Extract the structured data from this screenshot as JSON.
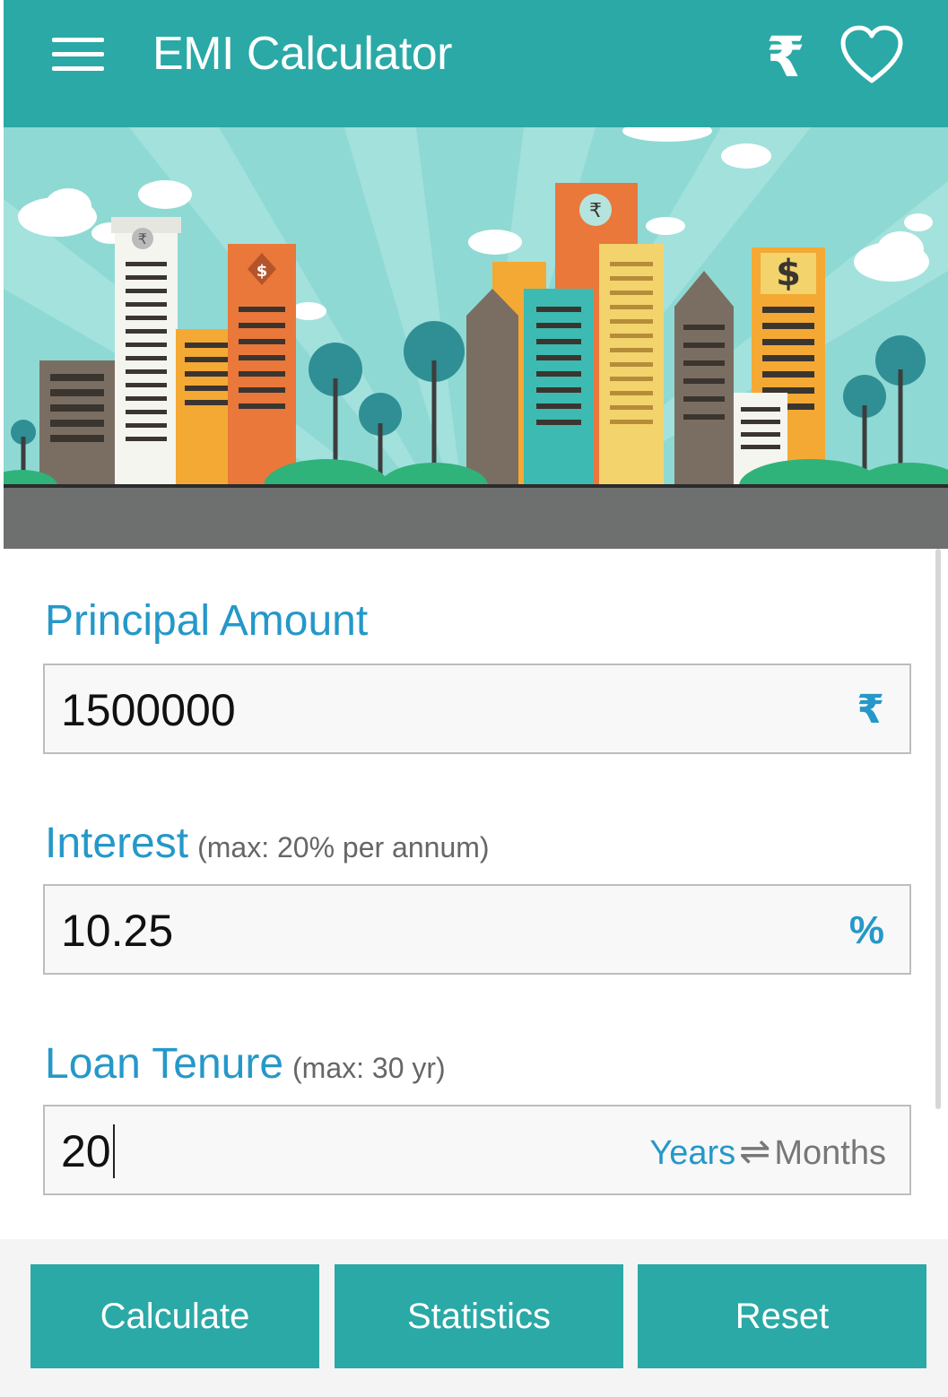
{
  "appbar": {
    "title": "EMI Calculator",
    "currency_symbol": "₹",
    "icons": [
      "menu-icon",
      "rupee-icon",
      "heart-icon"
    ]
  },
  "banner": {
    "rupee_sign": "₹",
    "dollar_sign": "$"
  },
  "principal": {
    "label": "Principal Amount",
    "value": "1500000",
    "suffix": "₹"
  },
  "interest": {
    "label": "Interest",
    "hint": "(max: 20% per annum)",
    "value": "10.25",
    "suffix": "%"
  },
  "tenure": {
    "label": "Loan Tenure",
    "hint": "(max: 30 yr)",
    "value": "20",
    "unit_active": "Years",
    "unit_inactive": "Months"
  },
  "buttons": {
    "calculate": "Calculate",
    "statistics": "Statistics",
    "reset": "Reset"
  },
  "colors": {
    "primary": "#2aa9a6",
    "label": "#2598c9",
    "sky": "#8fd9d4",
    "road": "#6e6f6f"
  }
}
